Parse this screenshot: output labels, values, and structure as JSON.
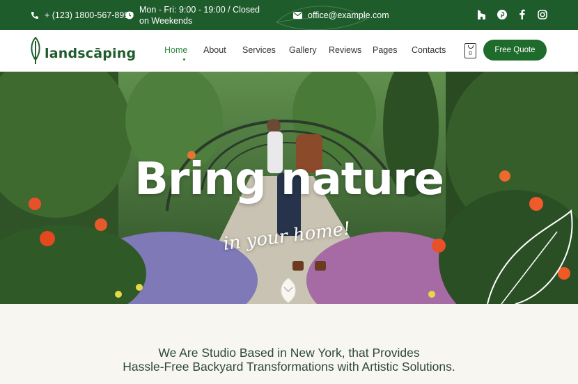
{
  "topbar": {
    "phone": "+ (123) 1800-567-8990",
    "hours": "Mon - Fri: 9:00 - 19:00 / Closed on Weekends",
    "email": "office@example.com",
    "social": [
      "houzz-icon",
      "pinterest-icon",
      "facebook-icon",
      "instagram-icon"
    ]
  },
  "header": {
    "logo_text": "landscāping",
    "menu": [
      "Home",
      "Services",
      "Gallery",
      "Reviews",
      "Pages",
      "Contacts"
    ],
    "menu_about": "About",
    "active_item": "Home",
    "cart_count": "0",
    "cta": "Free Quote"
  },
  "hero": {
    "headline": "Bring nature",
    "subline": "in your home!"
  },
  "intro": {
    "line1": "We Are Studio Based in New York, that Provides",
    "line2": "Hassle-Free Backyard Transformations with Artistic Solutions."
  },
  "colors": {
    "brand": "#1f5c2c",
    "accent": "#2f8a3c",
    "cta": "#1e6b2c",
    "background": "#f8f6f1"
  }
}
